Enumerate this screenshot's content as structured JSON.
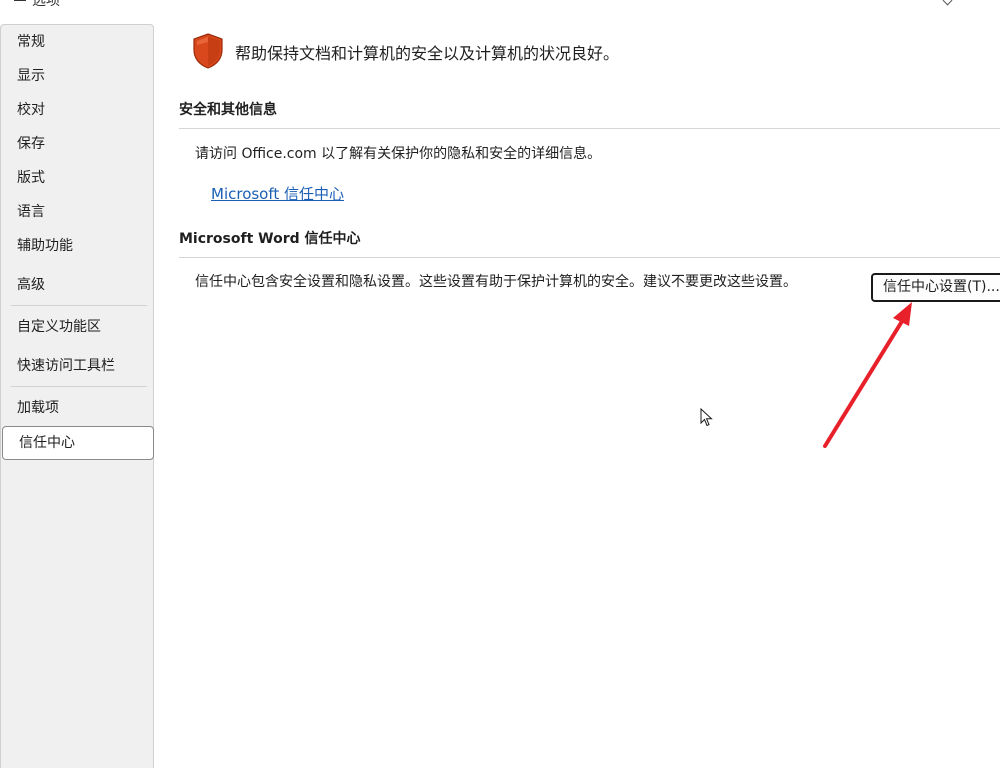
{
  "window": {
    "title_fragment": "选项"
  },
  "sidebar": {
    "items": [
      {
        "label": "常规"
      },
      {
        "label": "显示"
      },
      {
        "label": "校对"
      },
      {
        "label": "保存"
      },
      {
        "label": "版式"
      },
      {
        "label": "语言"
      },
      {
        "label": "辅助功能"
      },
      {
        "label": "高级"
      },
      {
        "label": "自定义功能区"
      },
      {
        "label": "快速访问工具栏"
      },
      {
        "label": "加载项"
      },
      {
        "label": "信任中心"
      }
    ],
    "selected": "信任中心"
  },
  "main": {
    "headline": "帮助保持文档和计算机的安全以及计算机的状况良好。",
    "security_section": {
      "title": "安全和其他信息",
      "text": "请访问 Office.com  以了解有关保护你的隐私和安全的详细信息。",
      "link": "Microsoft 信任中心"
    },
    "trust_center_section": {
      "title": "Microsoft Word 信任中心",
      "text": "信任中心包含安全设置和隐私设置。这些设置有助于保护计算机的安全。建议不要更改这些设置。",
      "button_label": "信任中心设置(T)..."
    }
  },
  "colors": {
    "sidebar_bg": "#f0f0f0",
    "link": "#1b5fb5",
    "shield": "#d9481c",
    "annotation_arrow": "#e8202a"
  },
  "icons": {
    "shield": "shield-icon",
    "cursor": "mouse-cursor-icon"
  }
}
